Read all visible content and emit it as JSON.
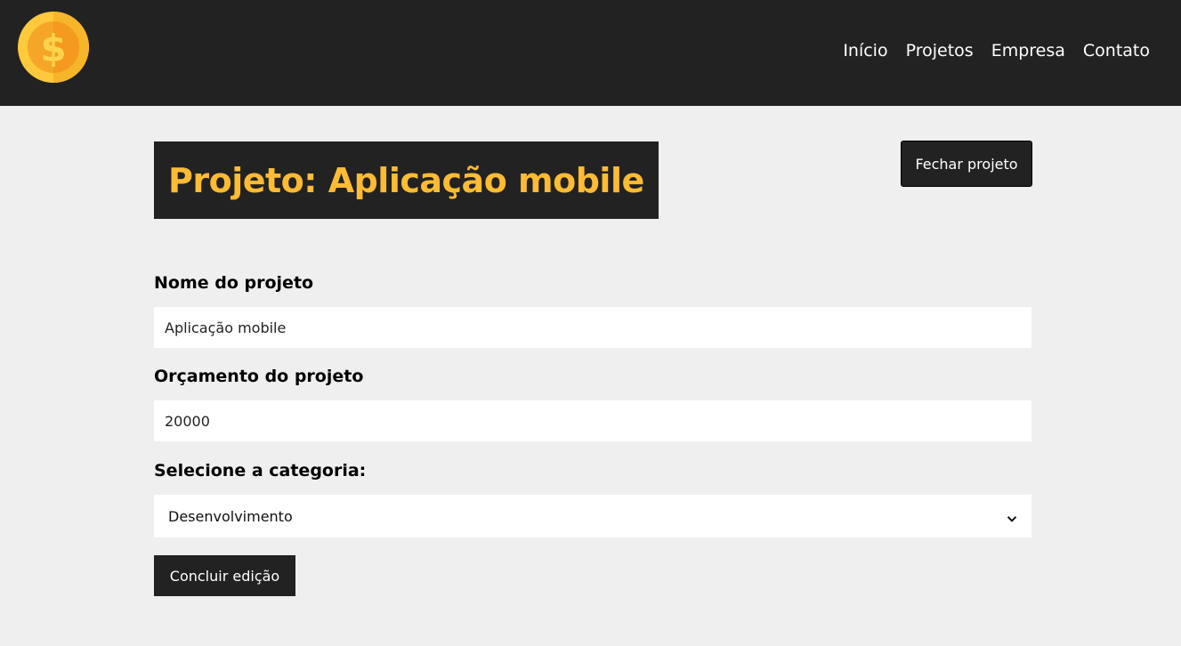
{
  "navbar": {
    "logo_icon": "dollar-coin-icon",
    "links": [
      {
        "label": "Início"
      },
      {
        "label": "Projetos"
      },
      {
        "label": "Empresa"
      },
      {
        "label": "Contato"
      }
    ]
  },
  "project": {
    "title": "Projeto: Aplicação mobile",
    "close_label": "Fechar projeto"
  },
  "form": {
    "name_label": "Nome do projeto",
    "name_value": "Aplicação mobile",
    "budget_label": "Orçamento do projeto",
    "budget_value": "20000",
    "category_label": "Selecione a categoria:",
    "category_selected": "Desenvolvimento",
    "submit_label": "Concluir edição"
  },
  "colors": {
    "navbar_bg": "#222222",
    "page_bg": "#efefef",
    "accent": "#ffbb33"
  }
}
